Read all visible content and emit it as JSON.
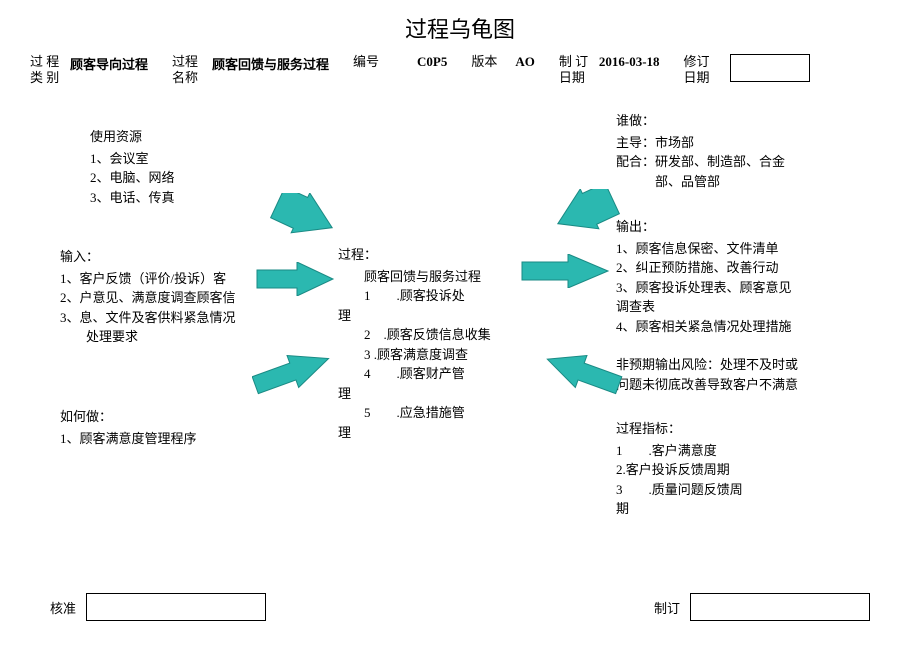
{
  "title": "过程乌龟图",
  "header": {
    "cat_label": "过 程\n类 别",
    "cat_value": "顾客导向过程",
    "name_label": "过程\n名称",
    "name_value": "顾客回馈与服务过程",
    "num_label": "编号",
    "num_value": "C0P5",
    "ver_label": "版本",
    "ver_value": "AO",
    "make_label": "制 订\n日期",
    "make_value": "2016-03-18",
    "rev_label": "修订\n日期"
  },
  "resources": {
    "heading": "使用资源",
    "l1": "1、会议室",
    "l2": "2、电脑、网络",
    "l3": "3、电话、传真"
  },
  "input": {
    "heading": "输入：",
    "l1": "1、客户反馈（评价/投诉）客",
    "l2": "2、户意见、满意度调查顾客信",
    "l3": "3、息、文件及客供料紧急情况",
    "l4": "        处理要求"
  },
  "how": {
    "heading": "如何做：",
    "l1": "1、顾客满意度管理程序"
  },
  "process": {
    "heading": "过程：",
    "name": "        顾客回馈与服务过程",
    "l1a": "        1        .顾客投诉处",
    "l1b": "理",
    "l2": "        2    .顾客反馈信息收集",
    "l3": "        3 .顾客满意度调查",
    "l4a": "        4        .顾客财产管",
    "l4b": "理",
    "l5a": "        5        .应急措施管",
    "l5b": "理"
  },
  "who": {
    "heading": "谁做：",
    "l1": "主导：市场部",
    "l2": "配合：研发部、制造部、合金",
    "l3": "            部、品管部"
  },
  "output": {
    "heading": "输出：",
    "l1": "1、顾客信息保密、文件清单",
    "l2": "2、纠正预防措施、改善行动",
    "l3": "3、顾客投诉处理表、顾客意见",
    "l4": "调查表",
    "l5": "4、顾客相关紧急情况处理措施"
  },
  "risk": {
    "l1": "非预期输出风险：处理不及时或",
    "l2": "问题未彻底改善导致客户不满意"
  },
  "indicator": {
    "heading": "过程指标：",
    "l1": "1        .客户满意度",
    "l2": "2.客户投诉反馈周期",
    "l3": "3        .质量问题反馈周",
    "l4": "期"
  },
  "approve": "核准",
  "make": "制订"
}
